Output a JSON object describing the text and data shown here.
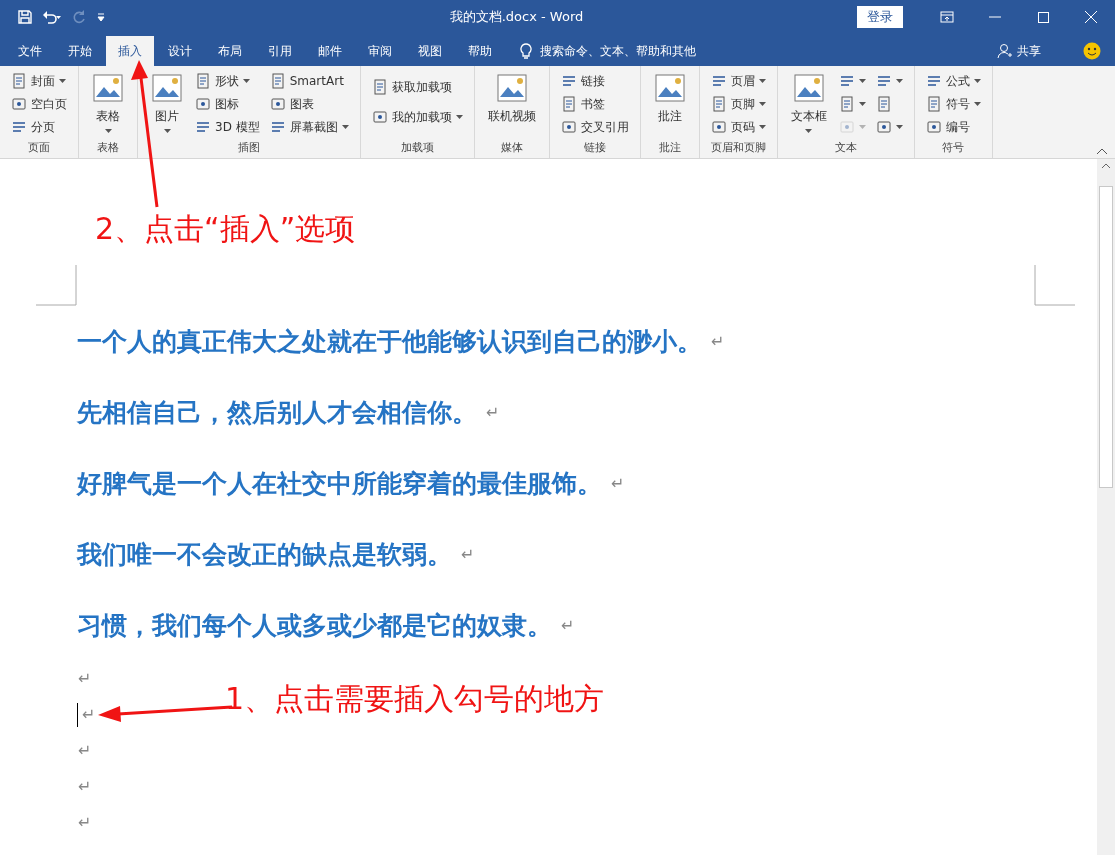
{
  "window": {
    "title": "我的文档.docx  -  Word",
    "login": "登录"
  },
  "tabs": [
    {
      "label": "文件",
      "selected": false
    },
    {
      "label": "开始",
      "selected": false
    },
    {
      "label": "插入",
      "selected": true
    },
    {
      "label": "设计",
      "selected": false
    },
    {
      "label": "布局",
      "selected": false
    },
    {
      "label": "引用",
      "selected": false
    },
    {
      "label": "邮件",
      "selected": false
    },
    {
      "label": "审阅",
      "selected": false
    },
    {
      "label": "视图",
      "selected": false
    },
    {
      "label": "帮助",
      "selected": false
    }
  ],
  "search": {
    "placeholder": "搜索命令、文本、帮助和其他"
  },
  "share": "共享",
  "ribbon": [
    {
      "name": "页面",
      "columns": [
        {
          "kind": "stack",
          "items": [
            {
              "label": "封面",
              "dropdown": true,
              "disabled": false
            },
            {
              "label": "空白页",
              "dropdown": false,
              "disabled": false
            },
            {
              "label": "分页",
              "dropdown": false,
              "disabled": false
            }
          ]
        }
      ]
    },
    {
      "name": "表格",
      "columns": [
        {
          "kind": "large",
          "label": "表格",
          "dropdown": true
        }
      ]
    },
    {
      "name": "插图",
      "columns": [
        {
          "kind": "large",
          "label": "图片",
          "dropdown": true
        },
        {
          "kind": "stack",
          "items": [
            {
              "label": "形状",
              "dropdown": true,
              "disabled": false
            },
            {
              "label": "图标",
              "dropdown": false,
              "disabled": false
            },
            {
              "label": "3D 模型",
              "dropdown": false,
              "disabled": false
            }
          ]
        },
        {
          "kind": "stack",
          "items": [
            {
              "label": "SmartArt",
              "dropdown": false,
              "disabled": false
            },
            {
              "label": "图表",
              "dropdown": false,
              "disabled": false
            },
            {
              "label": "屏幕截图",
              "dropdown": true,
              "disabled": false
            }
          ]
        }
      ]
    },
    {
      "name": "加载项",
      "columns": [
        {
          "kind": "stack",
          "items": [
            {
              "label": "获取加载项",
              "dropdown": false,
              "disabled": false
            },
            {
              "label": "我的加载项",
              "dropdown": true,
              "disabled": false
            }
          ]
        }
      ]
    },
    {
      "name": "媒体",
      "columns": [
        {
          "kind": "large",
          "label": "联机视频",
          "dropdown": false
        }
      ]
    },
    {
      "name": "链接",
      "columns": [
        {
          "kind": "stack",
          "items": [
            {
              "label": "链接",
              "dropdown": false,
              "disabled": false
            },
            {
              "label": "书签",
              "dropdown": false,
              "disabled": false
            },
            {
              "label": "交叉引用",
              "dropdown": false,
              "disabled": false
            }
          ]
        }
      ]
    },
    {
      "name": "批注",
      "columns": [
        {
          "kind": "large",
          "label": "批注",
          "dropdown": false
        }
      ]
    },
    {
      "name": "页眉和页脚",
      "columns": [
        {
          "kind": "stack",
          "items": [
            {
              "label": "页眉",
              "dropdown": true,
              "disabled": false
            },
            {
              "label": "页脚",
              "dropdown": true,
              "disabled": false
            },
            {
              "label": "页码",
              "dropdown": true,
              "disabled": false
            }
          ]
        }
      ]
    },
    {
      "name": "文本",
      "columns": [
        {
          "kind": "large",
          "label": "文本框",
          "dropdown": true
        },
        {
          "kind": "stack",
          "items": [
            {
              "dropdown": true,
              "disabled": false
            },
            {
              "dropdown": true,
              "disabled": false
            },
            {
              "dropdown": true,
              "disabled": true
            }
          ]
        },
        {
          "kind": "stack",
          "items": [
            {
              "dropdown": true,
              "disabled": false
            },
            {
              "dropdown": false,
              "disabled": false
            },
            {
              "dropdown": true,
              "disabled": false
            }
          ]
        }
      ]
    },
    {
      "name": "符号",
      "columns": [
        {
          "kind": "stack",
          "items": [
            {
              "label": "公式",
              "dropdown": true,
              "disabled": false
            },
            {
              "label": "符号",
              "dropdown": true,
              "disabled": false
            },
            {
              "label": "编号",
              "dropdown": false,
              "disabled": false
            }
          ]
        }
      ]
    }
  ],
  "document": {
    "paragraphs": [
      {
        "text": "一个人的真正伟大之处就在于他能够认识到自己的渺小。",
        "mark": "↵",
        "cursor": false
      },
      {
        "text": "先相信自己，然后别人才会相信你。",
        "mark": "↵",
        "cursor": false
      },
      {
        "text": "好脾气是一个人在社交中所能穿着的最佳服饰。",
        "mark": "↵",
        "cursor": false
      },
      {
        "text": "我们唯一不会改正的缺点是软弱。",
        "mark": "↵",
        "cursor": false
      },
      {
        "text": "习惯，我们每个人或多或少都是它的奴隶。",
        "mark": "↵",
        "cursor": false
      },
      {
        "mark": "↵",
        "cursor": false
      },
      {
        "mark": "↵",
        "cursor": true
      },
      {
        "mark": "↵",
        "cursor": false
      },
      {
        "mark": "↵",
        "cursor": false
      },
      {
        "mark": "↵",
        "cursor": false
      }
    ]
  },
  "annotations": [
    {
      "text": "2、点击“插入”选项"
    },
    {
      "text": "1、点击需要插入勾号的地方"
    }
  ]
}
